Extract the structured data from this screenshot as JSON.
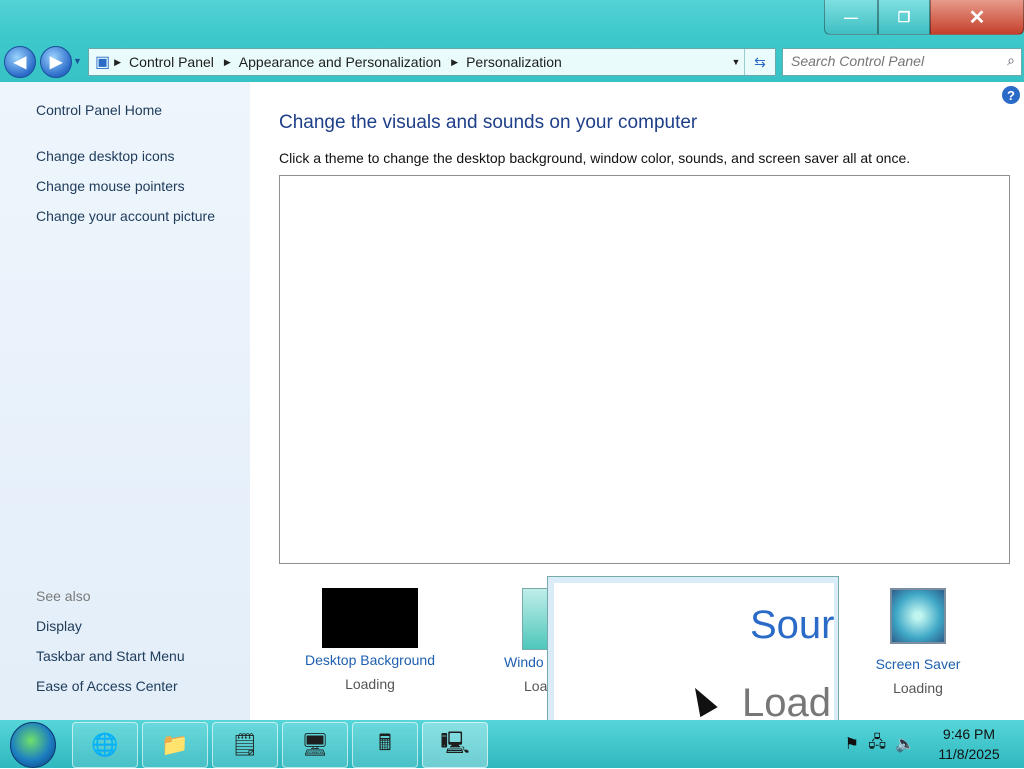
{
  "window": {
    "buttons": {
      "minimize": "—",
      "maximize": "❐",
      "close": "✕"
    }
  },
  "nav": {
    "back": "◀",
    "forward": "▶",
    "breadcrumb": [
      "Control Panel",
      "Appearance and Personalization",
      "Personalization"
    ],
    "search_placeholder": "Search Control Panel"
  },
  "sidebar": {
    "home": "Control Panel Home",
    "links": [
      "Change desktop icons",
      "Change mouse pointers",
      "Change your account picture"
    ],
    "see_also_label": "See also",
    "see_also": [
      "Display",
      "Taskbar and Start Menu",
      "Ease of Access Center"
    ]
  },
  "main": {
    "heading": "Change the visuals and sounds on your computer",
    "subtext": "Click a theme to change the desktop background, window color, sounds, and screen saver all at once.",
    "items": [
      {
        "label": "Desktop Background",
        "status": "Loading"
      },
      {
        "label": "Windo",
        "status": "Loa"
      },
      {
        "label": "Screen Saver",
        "status": "Loading"
      }
    ]
  },
  "tooltip": {
    "line1": "Sour",
    "line2": "Load"
  },
  "taskbar": {
    "clock_time": "9:46 PM",
    "clock_date": "11/8/2025"
  }
}
